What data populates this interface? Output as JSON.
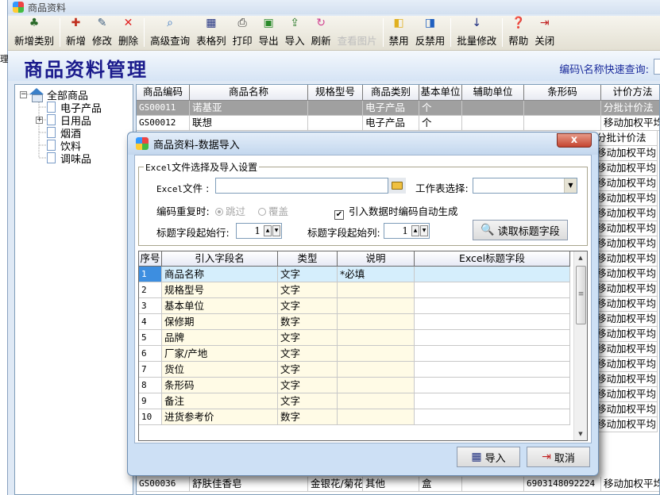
{
  "window": {
    "title": "商品资料"
  },
  "left_strip_chars": [
    "理"
  ],
  "toolbar": {
    "items": [
      {
        "label": "新增类别",
        "icon": "category-tree-icon",
        "glyph": "♣",
        "color": "#2a6a2a",
        "disabled": false
      },
      {
        "label": "新增",
        "icon": "add-icon",
        "glyph": "✚",
        "color": "#c03020",
        "disabled": false
      },
      {
        "label": "修改",
        "icon": "edit-icon",
        "glyph": "✎",
        "color": "#406080",
        "disabled": false
      },
      {
        "label": "删除",
        "icon": "delete-icon",
        "glyph": "✕",
        "color": "#e02020",
        "disabled": false
      },
      {
        "label": "高级查询",
        "icon": "advanced-search-icon",
        "glyph": "⌕",
        "color": "#3070c0",
        "disabled": false
      },
      {
        "label": "表格列",
        "icon": "table-columns-icon",
        "glyph": "▦",
        "color": "#203080",
        "disabled": false
      },
      {
        "label": "打印",
        "icon": "print-icon",
        "glyph": "⎙",
        "color": "#333333",
        "disabled": false
      },
      {
        "label": "导出",
        "icon": "export-excel-icon",
        "glyph": "▣",
        "color": "#2a8a2a",
        "disabled": false
      },
      {
        "label": "导入",
        "icon": "import-icon",
        "glyph": "⇪",
        "color": "#2a7a2a",
        "disabled": false
      },
      {
        "label": "刷新",
        "icon": "refresh-icon",
        "glyph": "↻",
        "color": "#d04090",
        "disabled": false
      },
      {
        "label": "查看图片",
        "icon": "view-image-icon",
        "glyph": "",
        "color": "#bdbdbd",
        "disabled": true
      },
      {
        "label": "禁用",
        "icon": "disable-icon",
        "glyph": "◧",
        "color": "#e0b020",
        "disabled": false
      },
      {
        "label": "反禁用",
        "icon": "enable-icon",
        "glyph": "◨",
        "color": "#2060c0",
        "disabled": false
      },
      {
        "label": "批量修改",
        "icon": "sort-az-icon",
        "glyph": "↓",
        "color": "#203080",
        "disabled": false
      },
      {
        "label": "帮助",
        "icon": "help-book-icon",
        "glyph": "❓",
        "color": "#b030b0",
        "disabled": false
      },
      {
        "label": "关闭",
        "icon": "exit-door-icon",
        "glyph": "⇥",
        "color": "#c02020",
        "disabled": false
      }
    ]
  },
  "header": {
    "title": "商品资料管理",
    "quick_search_label": "编码\\名称快速查询:",
    "quick_search_value": ""
  },
  "tree": {
    "root": "全部商品",
    "children": [
      {
        "label": "电子产品",
        "expandable": false
      },
      {
        "label": "日用品",
        "expandable": true
      },
      {
        "label": "烟酒",
        "expandable": false
      },
      {
        "label": "饮料",
        "expandable": false
      },
      {
        "label": "调味品",
        "expandable": false
      }
    ]
  },
  "grid": {
    "columns": [
      "商品编码",
      "商品名称",
      "规格型号",
      "商品类别",
      "基本单位",
      "辅助单位",
      "条形码",
      "计价方法"
    ],
    "rows": [
      {
        "code": "GS00011",
        "name": "诺基亚",
        "spec": "",
        "category": "电子产品",
        "unit": "个",
        "aux": "",
        "barcode": "",
        "pricing": "分批计价法",
        "selected": true
      },
      {
        "code": "GS00012",
        "name": "联想",
        "spec": "",
        "category": "电子产品",
        "unit": "个",
        "aux": "",
        "barcode": "",
        "pricing": "移动加权平均"
      }
    ],
    "pricing_column_visible": [
      "分批计价法",
      "移动加权平均",
      "分批计价法",
      "移动加权平均",
      "移动加权平均",
      "移动加权平均",
      "移动加权平均",
      "移动加权平均",
      "移动加权平均",
      "移动加权平均",
      "移动加权平均",
      "移动加权平均",
      "移动加权平均",
      "移动加权平均",
      "移动加权平均",
      "移动加权平均",
      "移动加权平均",
      "移动加权平均",
      "移动加权平均",
      "移动加权平均",
      "移动加权平均",
      "移动加权平均"
    ],
    "bottom_row": {
      "code": "GS00036",
      "name": "舒肤佳香皂",
      "spec": "金银花/菊花",
      "category": "其他",
      "unit": "盒",
      "aux": "",
      "barcode": "6903148092224",
      "pricing": "移动加权平均"
    }
  },
  "dialog": {
    "title": "商品资料-数据导入",
    "close_label": "x",
    "group_title_prefix": "Excel",
    "group_title": "文件选择及导入设置",
    "excel_file_label_prefix": "Excel",
    "excel_file_label": "文件 :",
    "excel_file_value": "",
    "sheet_label": "工作表选择:",
    "sheet_value": "",
    "dup_label": "编码重复时:",
    "dup_options": [
      {
        "label": "跳过",
        "selected": true
      },
      {
        "label": "覆盖",
        "selected": false
      }
    ],
    "auto_code_label": "引入数据时编码自动生成",
    "auto_code_checked": true,
    "start_row_label": "标题字段起始行:",
    "start_row_value": "1",
    "start_col_label": "标题字段起始列:",
    "start_col_value": "1",
    "read_button": "读取标题字段",
    "table": {
      "columns": [
        "序号",
        "引入字段名",
        "类型",
        "说明",
        "Excel标题字段"
      ],
      "rows": [
        {
          "no": "1",
          "field": "商品名称",
          "type": "文字",
          "note": "*必填",
          "excel": ""
        },
        {
          "no": "2",
          "field": "规格型号",
          "type": "文字",
          "note": "",
          "excel": ""
        },
        {
          "no": "3",
          "field": "基本单位",
          "type": "文字",
          "note": "",
          "excel": ""
        },
        {
          "no": "4",
          "field": "保修期",
          "type": "数字",
          "note": "",
          "excel": ""
        },
        {
          "no": "5",
          "field": "品牌",
          "type": "文字",
          "note": "",
          "excel": ""
        },
        {
          "no": "6",
          "field": "厂家/产地",
          "type": "文字",
          "note": "",
          "excel": ""
        },
        {
          "no": "7",
          "field": "货位",
          "type": "文字",
          "note": "",
          "excel": ""
        },
        {
          "no": "8",
          "field": "条形码",
          "type": "文字",
          "note": "",
          "excel": ""
        },
        {
          "no": "9",
          "field": "备注",
          "type": "文字",
          "note": "",
          "excel": ""
        },
        {
          "no": "10",
          "field": "进货参考价",
          "type": "数字",
          "note": "",
          "excel": ""
        }
      ]
    },
    "import_button": "导入",
    "cancel_button": "取消"
  }
}
